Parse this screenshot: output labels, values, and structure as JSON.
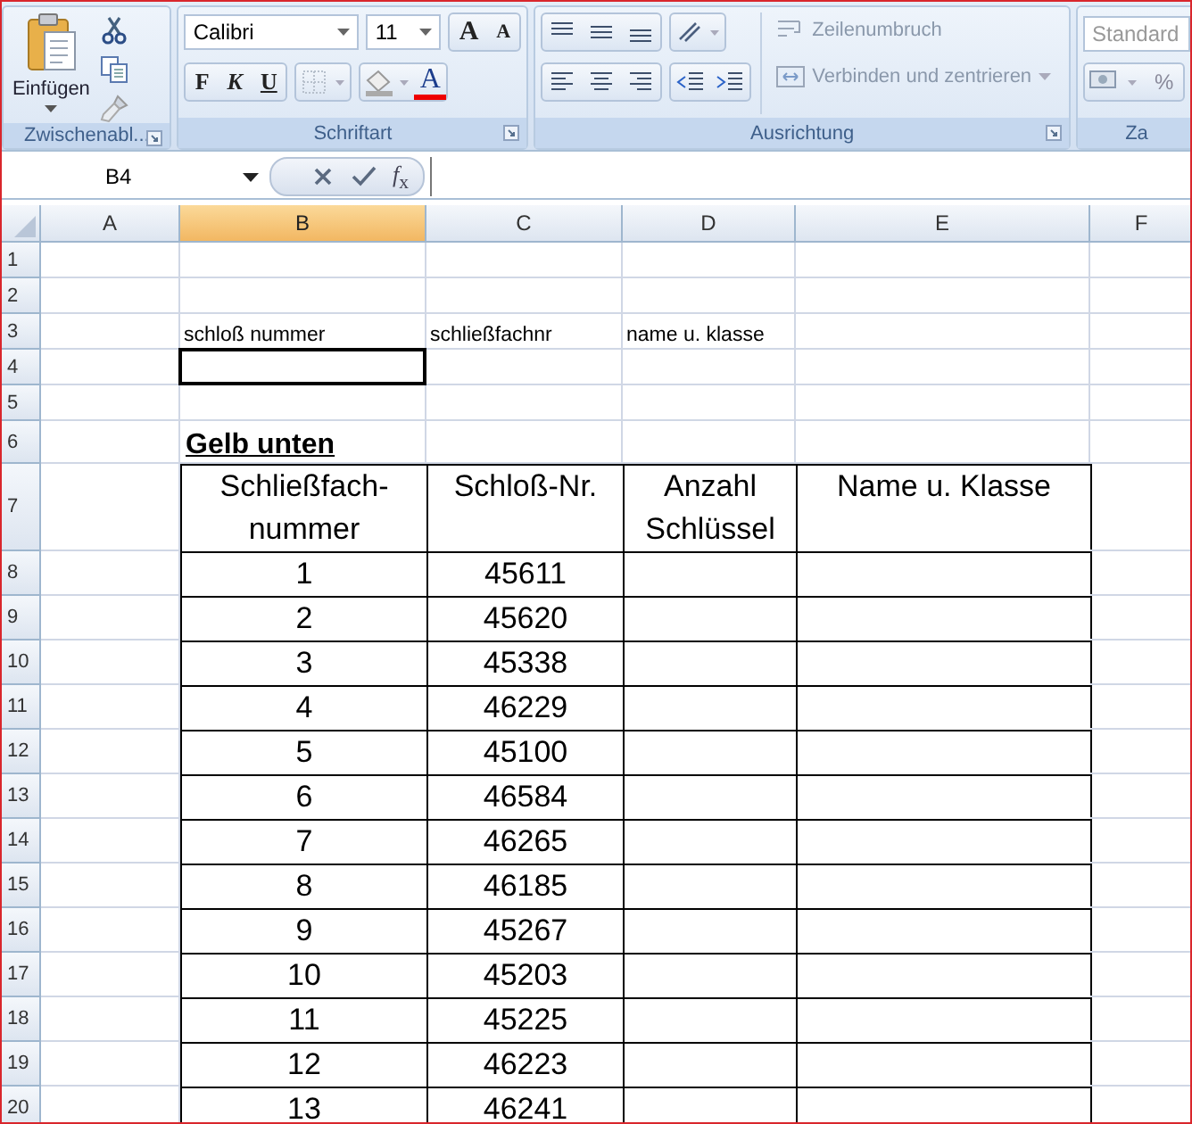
{
  "ribbon": {
    "groups": [
      {
        "kind": "clipboard",
        "label": "Zwischenabl...",
        "paste": "Einfügen"
      },
      {
        "kind": "font",
        "label": "Schriftart",
        "font_name": "Calibri",
        "font_size": "11",
        "grow": "A",
        "shrink": "A",
        "bold": "F",
        "italic": "K",
        "underline": "U",
        "font_color": "A"
      },
      {
        "kind": "alignment",
        "label": "Ausrichtung",
        "wrap": "Zeilenumbruch",
        "merge": "Verbinden und zentrieren"
      },
      {
        "kind": "number",
        "label": "Za",
        "format": "Standard",
        "percent": "%"
      }
    ]
  },
  "formula_bar": {
    "name_box": "B4",
    "fx": "*f*$_{x}$"
  },
  "columns": [
    {
      "label": "A",
      "selected": false
    },
    {
      "label": "B",
      "selected": true
    },
    {
      "label": "C",
      "selected": false
    },
    {
      "label": "D",
      "selected": false
    },
    {
      "label": "E",
      "selected": false
    },
    {
      "label": "F",
      "selected": false
    }
  ],
  "rows": [
    {
      "number": "1",
      "kind": "plain",
      "selected": false
    },
    {
      "number": "2",
      "kind": "plain",
      "selected": false
    },
    {
      "number": "3",
      "kind": "plain",
      "selected": false,
      "cells": [
        "schloß nummer",
        "schließfachnr",
        "name u. klasse"
      ]
    },
    {
      "number": "4",
      "kind": "plain",
      "selected": true
    },
    {
      "number": "5",
      "kind": "plain",
      "selected": false
    },
    {
      "number": "6",
      "kind": "title",
      "selected": false,
      "cells": [
        "Gelb unten"
      ]
    },
    {
      "number": "7",
      "kind": "table_head",
      "selected": false,
      "cells": [
        "Schließfach-nummer",
        "Schloß-Nr.",
        "Anzahl Schlüssel",
        "Name u. Klasse"
      ]
    },
    {
      "number": "8",
      "kind": "table_row",
      "selected": false,
      "cells": [
        "1",
        "45611"
      ]
    },
    {
      "number": "9",
      "kind": "table_row",
      "selected": false,
      "cells": [
        "2",
        "45620"
      ]
    },
    {
      "number": "10",
      "kind": "table_row",
      "selected": false,
      "cells": [
        "3",
        "45338"
      ]
    },
    {
      "number": "11",
      "kind": "table_row",
      "selected": false,
      "cells": [
        "4",
        "46229"
      ]
    },
    {
      "number": "12",
      "kind": "table_row",
      "selected": false,
      "cells": [
        "5",
        "45100"
      ]
    },
    {
      "number": "13",
      "kind": "table_row",
      "selected": false,
      "cells": [
        "6",
        "46584"
      ]
    },
    {
      "number": "14",
      "kind": "table_row",
      "selected": false,
      "cells": [
        "7",
        "46265"
      ]
    },
    {
      "number": "15",
      "kind": "table_row",
      "selected": false,
      "cells": [
        "8",
        "46185"
      ]
    },
    {
      "number": "16",
      "kind": "table_row",
      "selected": false,
      "cells": [
        "9",
        "45267"
      ]
    },
    {
      "number": "17",
      "kind": "table_row",
      "selected": false,
      "cells": [
        "10",
        "45203"
      ]
    },
    {
      "number": "18",
      "kind": "table_row",
      "selected": false,
      "cells": [
        "11",
        "45225"
      ]
    },
    {
      "number": "19",
      "kind": "table_row",
      "selected": false,
      "cells": [
        "12",
        "46223"
      ]
    },
    {
      "number": "20",
      "kind": "table_row",
      "selected": false,
      "cells": [
        "13",
        "46241"
      ]
    }
  ]
}
